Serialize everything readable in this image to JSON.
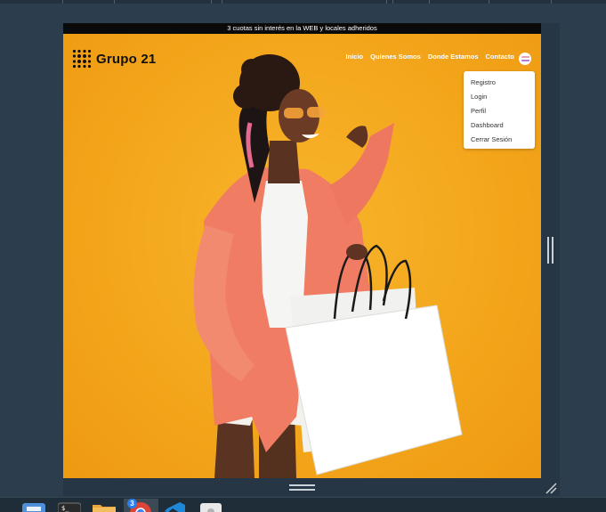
{
  "promo": {
    "text": "3 cuotas sin interés en la WEB y locales adheridos"
  },
  "brand": {
    "name": "Grupo 21"
  },
  "nav": {
    "items": [
      {
        "label": "Inicio"
      },
      {
        "label": "Quienes Somos"
      },
      {
        "label": "Donde Estamos"
      },
      {
        "label": "Contacto"
      }
    ]
  },
  "user_menu": {
    "items": [
      {
        "label": "Registro"
      },
      {
        "label": "Login"
      },
      {
        "label": "Perfil"
      },
      {
        "label": "Dashboard"
      },
      {
        "label": "Cerrar Sesión"
      }
    ]
  },
  "hero": {
    "image": "woman-with-shopping-bags-on-yellow-background"
  },
  "taskbar": {
    "apps": [
      {
        "name": "file-manager-icon"
      },
      {
        "name": "terminal-icon"
      },
      {
        "name": "folder-icon"
      },
      {
        "name": "chrome-icon",
        "badge": "3"
      },
      {
        "name": "vscode-icon"
      },
      {
        "name": "disk-utility-icon"
      }
    ]
  },
  "colors": {
    "hero_background": "#f4a51c",
    "promo_bar": "#0a0a0a",
    "window_background": "#2c3e4d",
    "jacket": "#f07c63"
  }
}
